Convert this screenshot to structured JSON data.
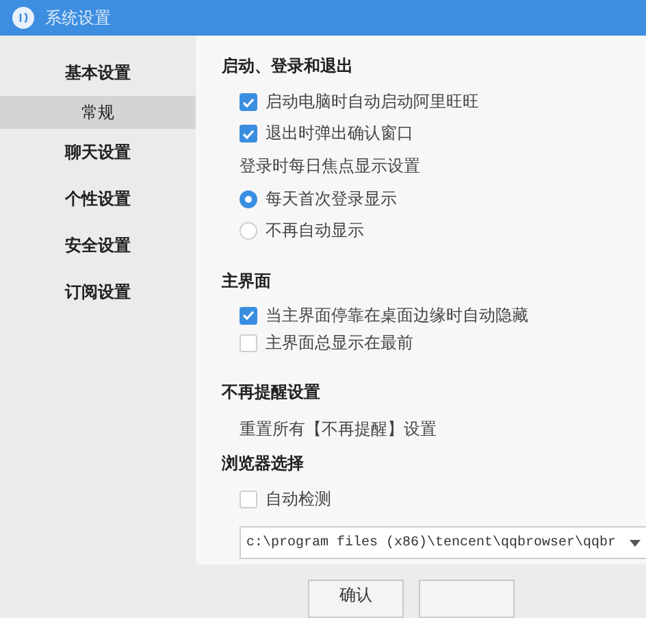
{
  "window": {
    "title": "系统设置"
  },
  "sidebar": {
    "items": [
      {
        "label": "基本设置",
        "selected": false,
        "children": [
          {
            "label": "常规",
            "selected": true
          }
        ]
      },
      {
        "label": "聊天设置",
        "selected": false
      },
      {
        "label": "个性设置",
        "selected": false
      },
      {
        "label": "安全设置",
        "selected": false
      },
      {
        "label": "订阅设置",
        "selected": false
      }
    ]
  },
  "sections": [
    {
      "title": "启动、登录和退出",
      "items": [
        {
          "kind": "checkbox",
          "label": "启动电脑时自动启动阿里旺旺",
          "checked": true
        },
        {
          "kind": "checkbox",
          "label": "退出时弹出确认窗口",
          "checked": true
        },
        {
          "kind": "text",
          "label": "登录时每日焦点显示设置"
        },
        {
          "kind": "radio",
          "label": "每天首次登录显示",
          "selected": true
        },
        {
          "kind": "radio",
          "label": "不再自动显示",
          "selected": false
        }
      ]
    },
    {
      "title": "主界面",
      "items": [
        {
          "kind": "checkbox",
          "label": "当主界面停靠在桌面边缘时自动隐藏",
          "checked": true
        },
        {
          "kind": "checkbox",
          "label": "主界面总显示在最前",
          "checked": false
        }
      ]
    },
    {
      "title": "不再提醒设置",
      "items": [
        {
          "kind": "text",
          "label": "重置所有【不再提醒】设置"
        }
      ]
    },
    {
      "title": "浏览器选择",
      "items": [
        {
          "kind": "checkbox",
          "label": "自动检测",
          "checked": false
        },
        {
          "kind": "select",
          "value": "c:\\program files (x86)\\tencent\\qqbrowser\\qqbr"
        }
      ]
    }
  ],
  "buttons": [
    "确认"
  ]
}
